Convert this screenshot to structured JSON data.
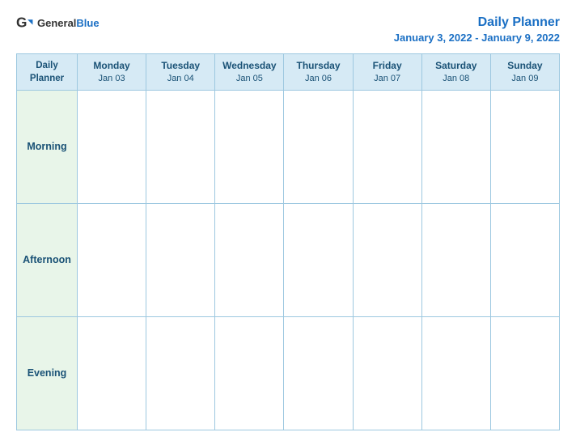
{
  "logo": {
    "general": "General",
    "blue": "Blue"
  },
  "title": {
    "main": "Daily Planner",
    "subtitle": "January 3, 2022 - January 9, 2022"
  },
  "header": {
    "first_col_line1": "Daily",
    "first_col_line2": "Planner",
    "days": [
      {
        "name": "Monday",
        "date": "Jan 03"
      },
      {
        "name": "Tuesday",
        "date": "Jan 04"
      },
      {
        "name": "Wednesday",
        "date": "Jan 05"
      },
      {
        "name": "Thursday",
        "date": "Jan 06"
      },
      {
        "name": "Friday",
        "date": "Jan 07"
      },
      {
        "name": "Saturday",
        "date": "Jan 08"
      },
      {
        "name": "Sunday",
        "date": "Jan 09"
      }
    ]
  },
  "rows": [
    {
      "label": "Morning"
    },
    {
      "label": "Afternoon"
    },
    {
      "label": "Evening"
    }
  ]
}
